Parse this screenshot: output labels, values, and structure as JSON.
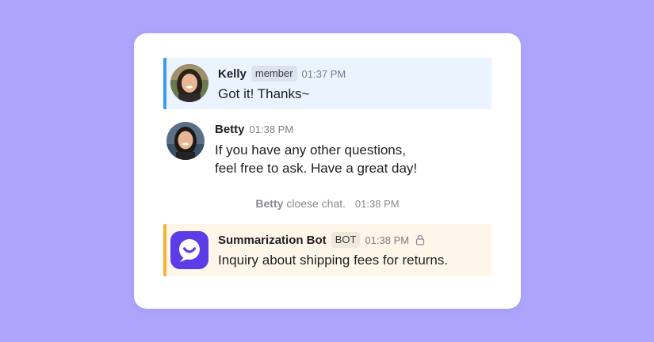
{
  "background_color": "#ada5fb",
  "messages": [
    {
      "name": "Kelly",
      "badge": "member",
      "time": "01:37 PM",
      "text": "Got it! Thanks~",
      "accent": "#3d9be9",
      "avatar": "avatar-photo-kelly"
    },
    {
      "name": "Betty",
      "time": "01:38 PM",
      "text": "If you have any other questions,\nfeel free to ask. Have a great day!",
      "avatar": "avatar-photo-betty"
    },
    {
      "name": "Summarization Bot",
      "badge": "BOT",
      "time": "01:38 PM",
      "text": "Inquiry about shipping fees for returns.",
      "accent": "#f1b434",
      "avatar": "bot-logo-icon",
      "icon": "lock-icon"
    }
  ],
  "system_event": {
    "name": "Betty",
    "text": "cloese chat.",
    "time": "01:38 PM"
  }
}
